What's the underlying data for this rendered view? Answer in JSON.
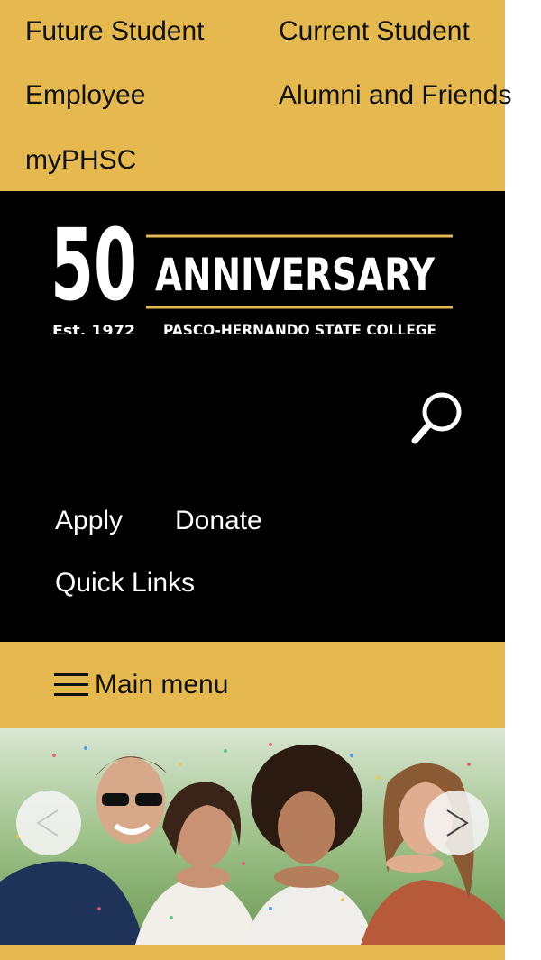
{
  "audience_nav": {
    "future_student": "Future Student",
    "current_student": "Current Student",
    "employee": "Employee",
    "alumni_friends": "Alumni and Friends",
    "myphsc": "myPHSC"
  },
  "logo": {
    "number": "50",
    "word": "ANNIVERSARY",
    "established": "Est. 1972",
    "college": "PASCO-HERNANDO STATE COLLEGE"
  },
  "utility_nav": {
    "apply": "Apply",
    "donate": "Donate",
    "quick_links": "Quick Links"
  },
  "main_menu": {
    "label": "Main menu"
  },
  "colors": {
    "gold": "#E5B94F",
    "header_bg": "#000000",
    "text_dark": "#111111",
    "text_light": "#ffffff"
  }
}
